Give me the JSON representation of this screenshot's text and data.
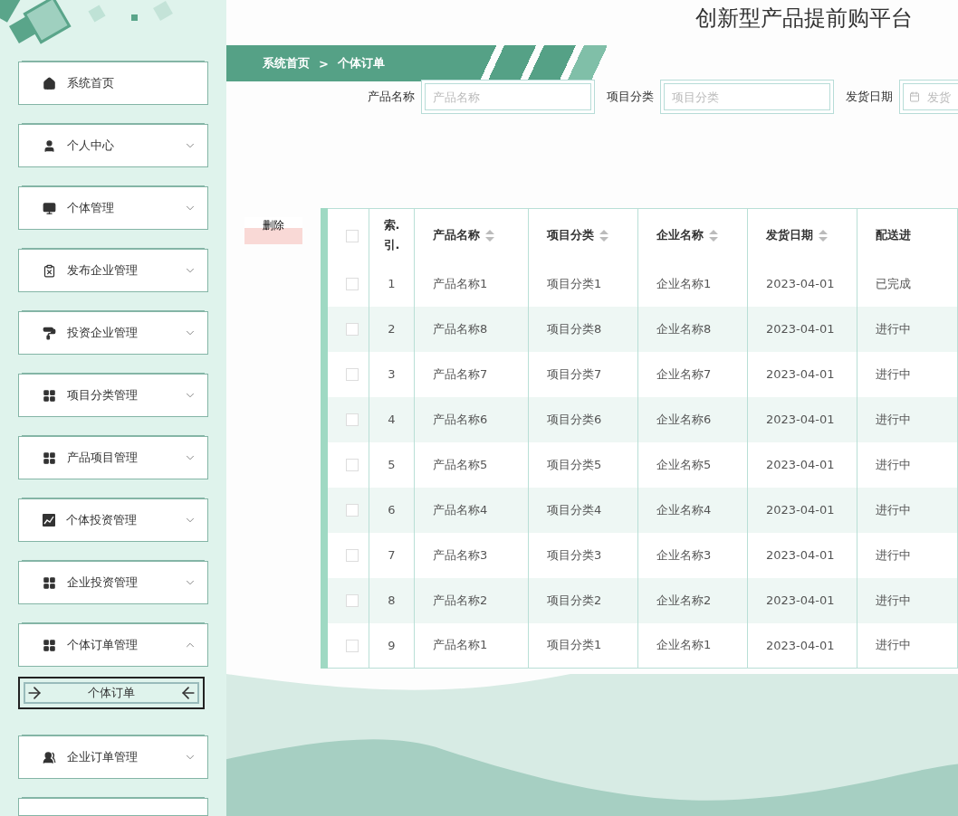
{
  "title": "创新型产品提前购平台",
  "sidebar": {
    "items": [
      {
        "label": "系统首页",
        "kind": "link"
      },
      {
        "label": "个人中心",
        "kind": "group",
        "expanded": false
      },
      {
        "label": "个体管理",
        "kind": "group",
        "expanded": false
      },
      {
        "label": "发布企业管理",
        "kind": "group",
        "expanded": false
      },
      {
        "label": "投资企业管理",
        "kind": "group",
        "expanded": false
      },
      {
        "label": "项目分类管理",
        "kind": "group",
        "expanded": false
      },
      {
        "label": "产品项目管理",
        "kind": "group",
        "expanded": false
      },
      {
        "label": "个体投资管理",
        "kind": "group",
        "expanded": false
      },
      {
        "label": "企业投资管理",
        "kind": "group",
        "expanded": false
      },
      {
        "label": "个体订单管理",
        "kind": "group",
        "expanded": true,
        "children": [
          {
            "label": "个体订单",
            "selected": true
          }
        ]
      },
      {
        "label": "企业订单管理",
        "kind": "group",
        "expanded": false
      }
    ]
  },
  "breadcrumb": [
    "系统首页",
    ">",
    "个体订单"
  ],
  "search": [
    {
      "label": "产品名称",
      "placeholder": "产品名称",
      "kind": "text"
    },
    {
      "label": "项目分类",
      "placeholder": "项目分类",
      "kind": "text"
    },
    {
      "label": "发货日期",
      "placeholder": "发货",
      "kind": "date"
    }
  ],
  "delete_button": "删除",
  "table": {
    "select_all": {
      "checked": false
    },
    "columns": [
      {
        "label": "索.引.",
        "sortable": false
      },
      {
        "label": "产品名称",
        "sortable": true
      },
      {
        "label": "项目分类",
        "sortable": true
      },
      {
        "label": "企业名称",
        "sortable": true
      },
      {
        "label": "发货日期",
        "sortable": true
      },
      {
        "label": "配送进",
        "sortable": false
      }
    ],
    "rows": [
      {
        "checked": false,
        "cells": [
          "1",
          "产品名称1",
          "项目分类1",
          "企业名称1",
          "2023-04-01",
          "已完成"
        ]
      },
      {
        "checked": false,
        "cells": [
          "2",
          "产品名称8",
          "项目分类8",
          "企业名称8",
          "2023-04-01",
          "进行中"
        ]
      },
      {
        "checked": false,
        "cells": [
          "3",
          "产品名称7",
          "项目分类7",
          "企业名称7",
          "2023-04-01",
          "进行中"
        ]
      },
      {
        "checked": false,
        "cells": [
          "4",
          "产品名称6",
          "项目分类6",
          "企业名称6",
          "2023-04-01",
          "进行中"
        ]
      },
      {
        "checked": false,
        "cells": [
          "5",
          "产品名称5",
          "项目分类5",
          "企业名称5",
          "2023-04-01",
          "进行中"
        ]
      },
      {
        "checked": false,
        "cells": [
          "6",
          "产品名称4",
          "项目分类4",
          "企业名称4",
          "2023-04-01",
          "进行中"
        ]
      },
      {
        "checked": false,
        "cells": [
          "7",
          "产品名称3",
          "项目分类3",
          "企业名称3",
          "2023-04-01",
          "进行中"
        ]
      },
      {
        "checked": false,
        "cells": [
          "8",
          "产品名称2",
          "项目分类2",
          "企业名称2",
          "2023-04-01",
          "进行中"
        ]
      },
      {
        "checked": false,
        "cells": [
          "9",
          "产品名称1",
          "项目分类1",
          "企业名称1",
          "2023-04-01",
          "进行中"
        ]
      }
    ]
  }
}
